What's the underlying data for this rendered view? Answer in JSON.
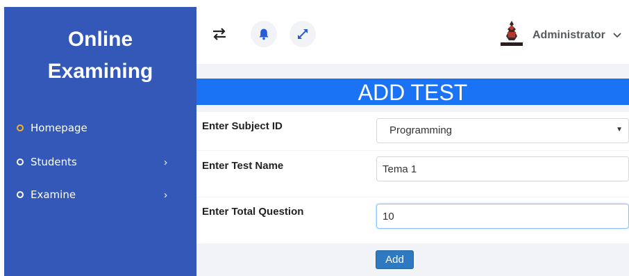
{
  "sidebar": {
    "brand_line1": "Online",
    "brand_line2": "Examining",
    "items": [
      {
        "label": "Homepage",
        "active": true,
        "has_submenu": false
      },
      {
        "label": "Students",
        "active": false,
        "has_submenu": true
      },
      {
        "label": "Examine",
        "active": false,
        "has_submenu": true
      }
    ],
    "chevron": "›"
  },
  "header": {
    "icons": [
      "swap-arrows-icon",
      "bell-icon",
      "expand-icon"
    ],
    "user_name": "Administrator",
    "avatar_icon": "user-avatar-icon"
  },
  "form": {
    "title": "ADD TEST",
    "subject_label": "Enter Subject ID",
    "subject_value": "Programming",
    "test_name_label": "Enter Test Name",
    "test_name_value": "Tema 1",
    "total_question_label": "Enter Total Question",
    "total_question_value": "10",
    "submit_label": "Add"
  },
  "colors": {
    "sidebar_bg": "#3358b8",
    "active_bullet": "#f5b520",
    "title_bar": "#1a73f5",
    "button": "#2f79c2"
  }
}
